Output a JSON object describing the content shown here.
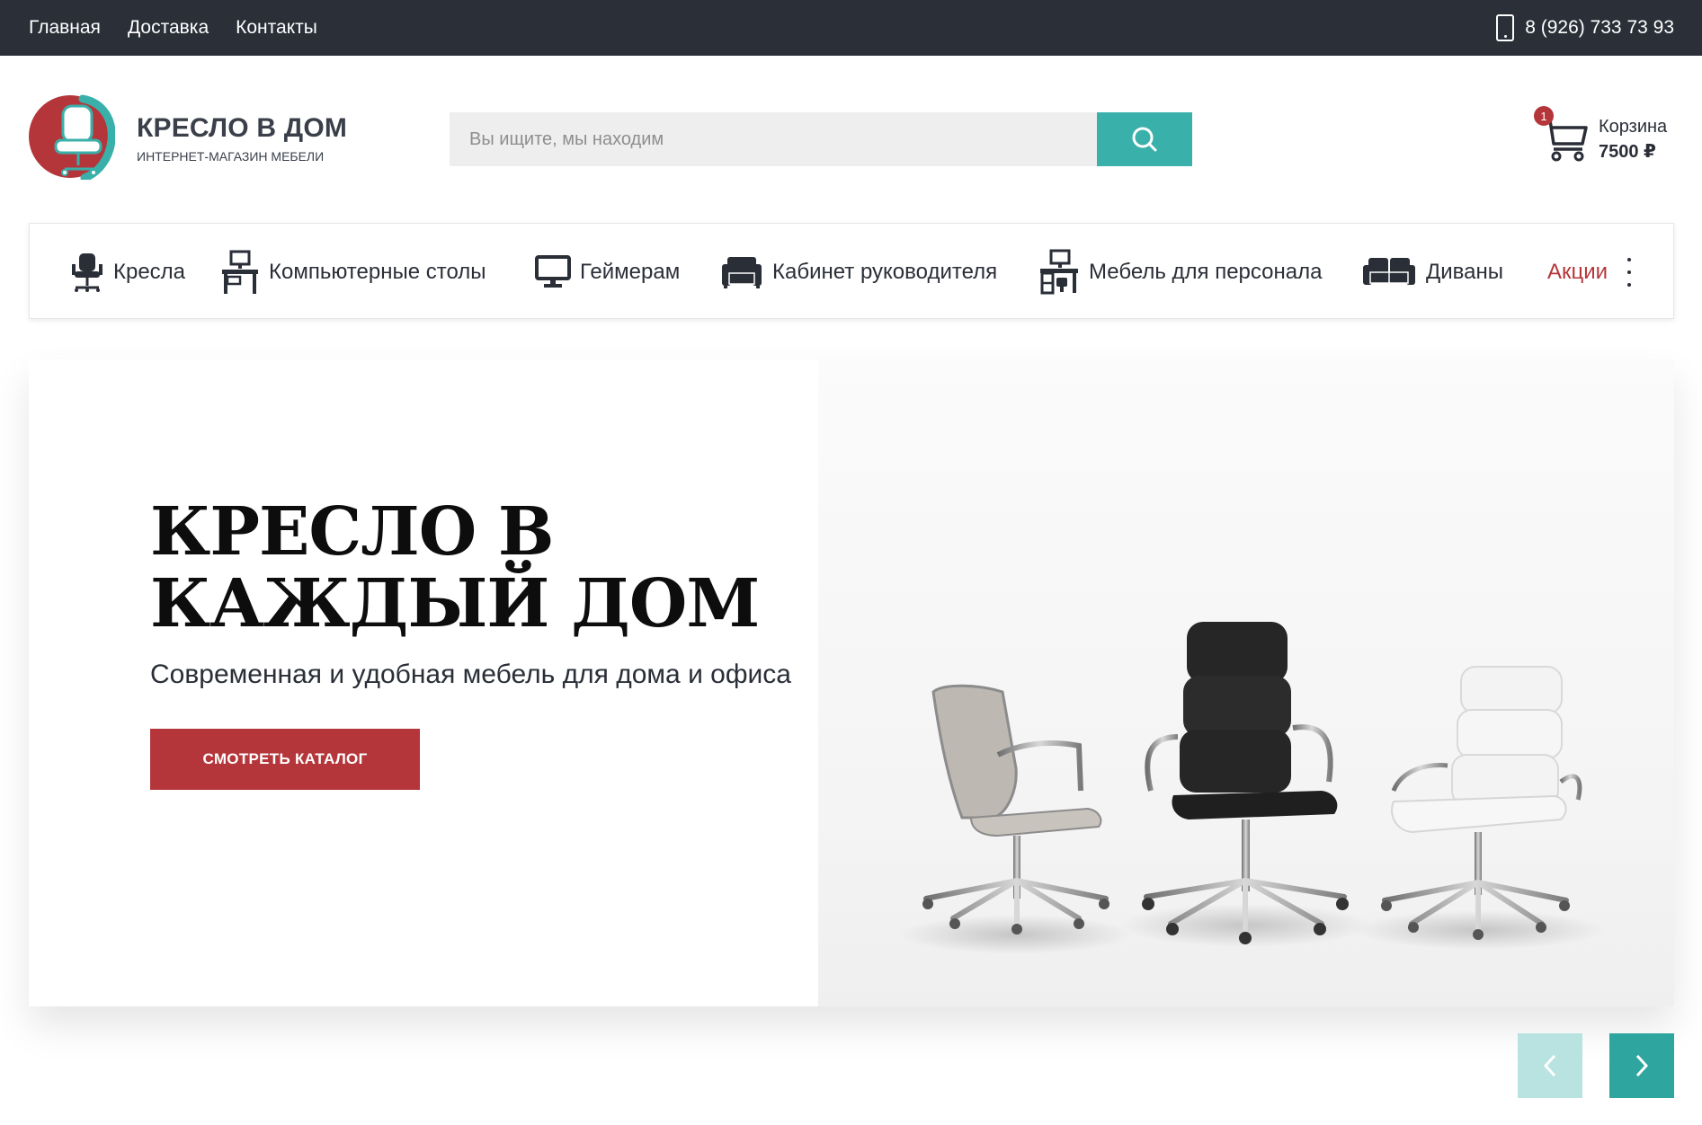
{
  "topbar": {
    "nav": [
      {
        "label": "Главная"
      },
      {
        "label": "Доставка"
      },
      {
        "label": "Контакты"
      }
    ],
    "phone": "8 (926) 733 73 93"
  },
  "header": {
    "logo_title": "КРЕСЛО В ДОМ",
    "logo_subtitle": "ИНТЕРНЕТ-МАГАЗИН МЕБЕЛИ",
    "search_placeholder": "Вы ищите, мы находим",
    "cart": {
      "label": "Корзина",
      "total": "7500 ₽",
      "count": "1"
    }
  },
  "categories": [
    {
      "label": "Кресла",
      "icon": "office-chair-icon"
    },
    {
      "label": "Компьютерные столы",
      "icon": "computer-desk-icon"
    },
    {
      "label": "Геймерам",
      "icon": "monitor-icon"
    },
    {
      "label": "Кабинет руководителя",
      "icon": "armchair-icon"
    },
    {
      "label": "Мебель для персонала",
      "icon": "workstation-icon"
    },
    {
      "label": "Диваны",
      "icon": "sofa-icon"
    },
    {
      "label": "Акции",
      "icon": ""
    }
  ],
  "hero": {
    "title_line1": "КРЕСЛО В",
    "title_line2": "КАЖДЫЙ ДОМ",
    "subtitle": "Современная и удобная мебель для дома и офиса",
    "button": "СМОТРЕТЬ КАТАЛОГ"
  },
  "colors": {
    "topbar": "#2a2f38",
    "accent_red": "#b5363a",
    "accent_teal": "#3ab0aa"
  }
}
